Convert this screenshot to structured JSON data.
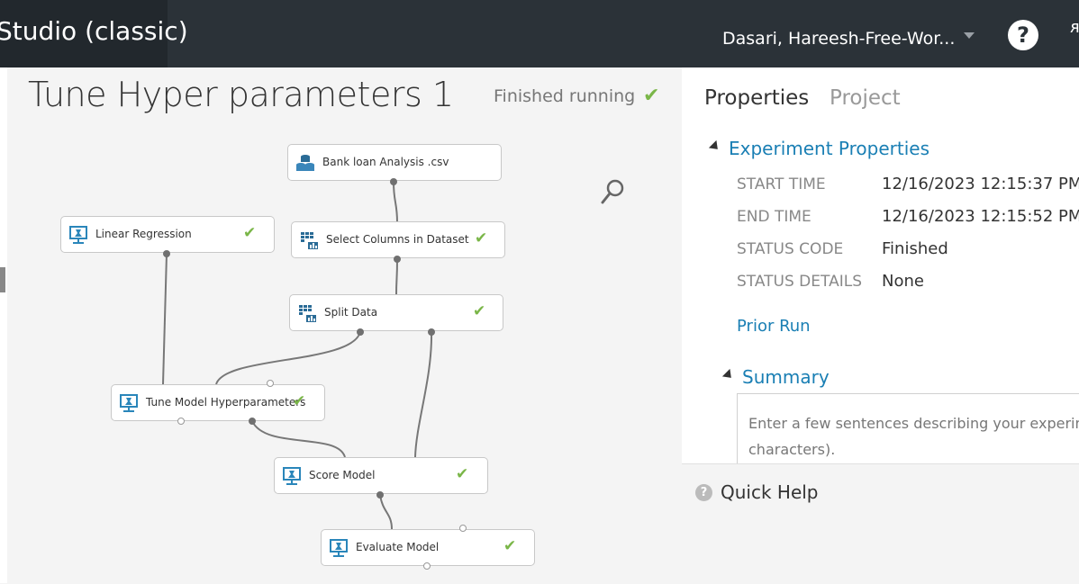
{
  "header": {
    "app_title": "Studio (classic)",
    "user": "Dasari, Hareesh-Free-Wor...",
    "help_label": "?",
    "cut_glyph": "ᴙ"
  },
  "experiment": {
    "title": "Tune Hyper parameters 1",
    "status": "Finished running"
  },
  "modules": [
    {
      "label": "Bank loan Analysis .csv",
      "icon": "dataset-icon",
      "done": false
    },
    {
      "label": "Linear Regression",
      "icon": "model-icon",
      "done": true
    },
    {
      "label": "Select Columns in Dataset",
      "icon": "table-icon",
      "done": true
    },
    {
      "label": "Split Data",
      "icon": "table-icon",
      "done": true
    },
    {
      "label": "Tune Model Hyperparameters",
      "icon": "model-icon",
      "done": true
    },
    {
      "label": "Score Model",
      "icon": "model-icon",
      "done": true
    },
    {
      "label": "Evaluate Model",
      "icon": "model-icon",
      "done": true
    }
  ],
  "panel": {
    "tabs": [
      "Properties",
      "Project"
    ],
    "experiment_properties": {
      "heading": "Experiment Properties",
      "rows": [
        {
          "label": "START TIME",
          "value": "12/16/2023 12:15:37 PM"
        },
        {
          "label": "END TIME",
          "value": "12/16/2023 12:15:52 PM"
        },
        {
          "label": "STATUS CODE",
          "value": "Finished"
        },
        {
          "label": "STATUS DETAILS",
          "value": "None"
        }
      ]
    },
    "prior_run": "Prior Run",
    "summary": {
      "heading": "Summary",
      "line1": "Enter a few sentences describing your experim",
      "line2": "characters)."
    },
    "quick_help": "Quick Help"
  },
  "colors": {
    "topbar": "#2b3238",
    "accent": "#1a7fb4",
    "success": "#7ab648"
  }
}
